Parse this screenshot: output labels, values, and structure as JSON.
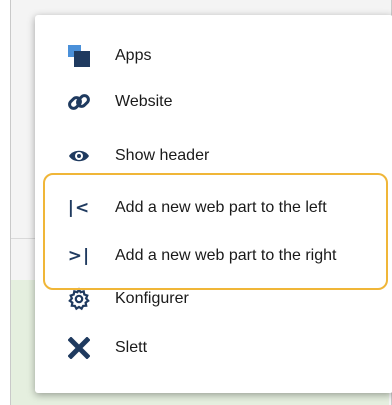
{
  "menu": {
    "items": [
      {
        "label": "Apps",
        "icon": "apps-icon"
      },
      {
        "label": "Website",
        "icon": "link-icon"
      },
      {
        "label": "Show header",
        "icon": "eye-icon"
      },
      {
        "label": "Add a new web part to the left",
        "icon": "add-left-icon",
        "glyph": "|<"
      },
      {
        "label": "Add a new web part to the right",
        "icon": "add-right-icon",
        "glyph": ">|"
      },
      {
        "label": "Konfigurer",
        "icon": "gear-icon"
      },
      {
        "label": "Slett",
        "icon": "delete-icon"
      }
    ]
  },
  "colors": {
    "icon": "#1f3a5f",
    "apps_light": "#4a90d9",
    "highlight": "#f0b638"
  }
}
